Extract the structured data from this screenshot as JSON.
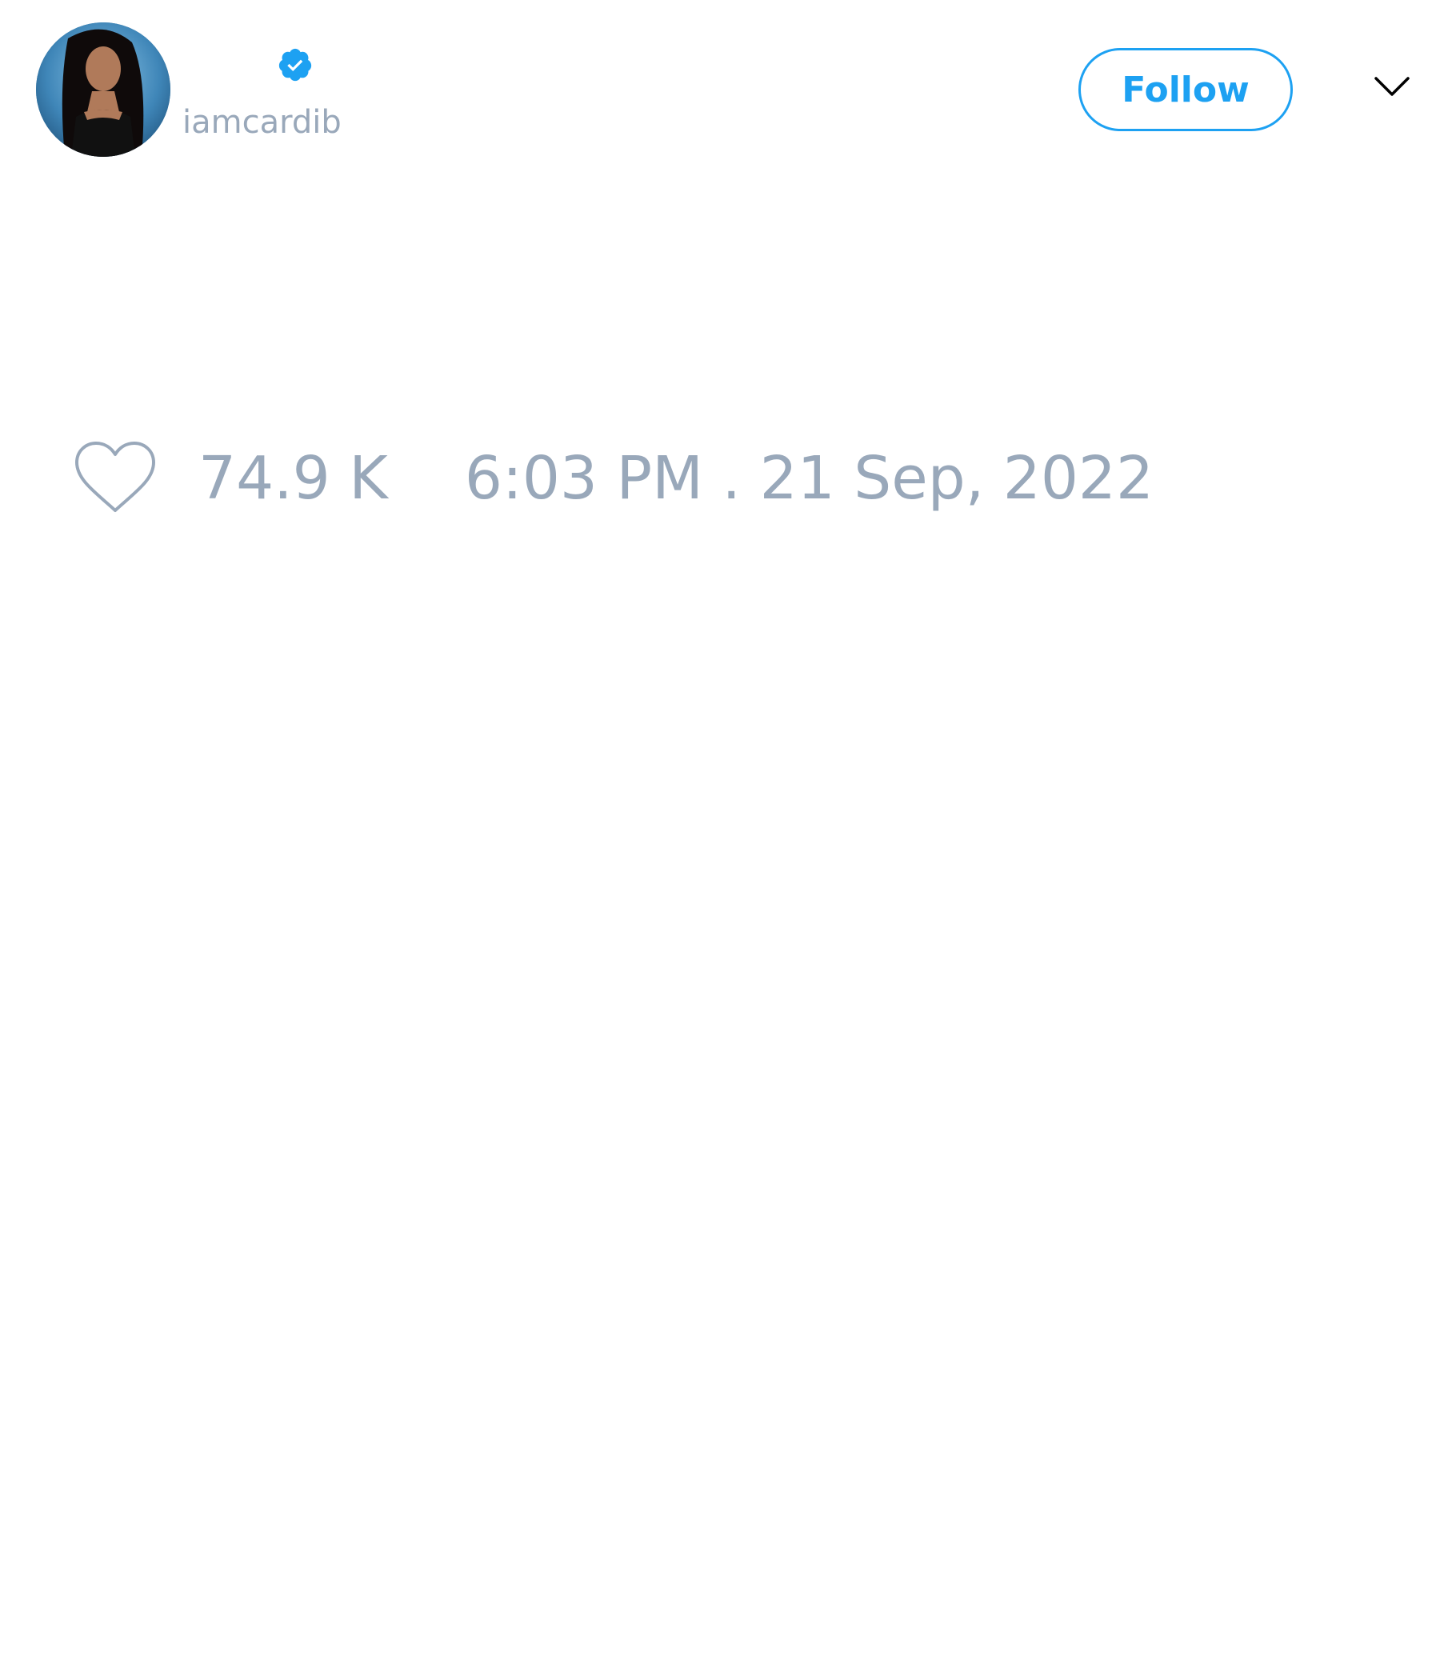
{
  "author": {
    "display_name": "",
    "handle": "iamcardib",
    "verified": true,
    "avatar": "profile-photo"
  },
  "header": {
    "follow_label": "Follow",
    "menu_icon": "chevron-down-icon"
  },
  "stats": {
    "like_icon": "heart-outline-icon",
    "like_count": "74.9 K",
    "timestamp": "6:03 PM . 21 Sep, 2022"
  },
  "colors": {
    "accent": "#1da1f2",
    "muted_text": "#99a8ba",
    "background": "#ffffff"
  }
}
